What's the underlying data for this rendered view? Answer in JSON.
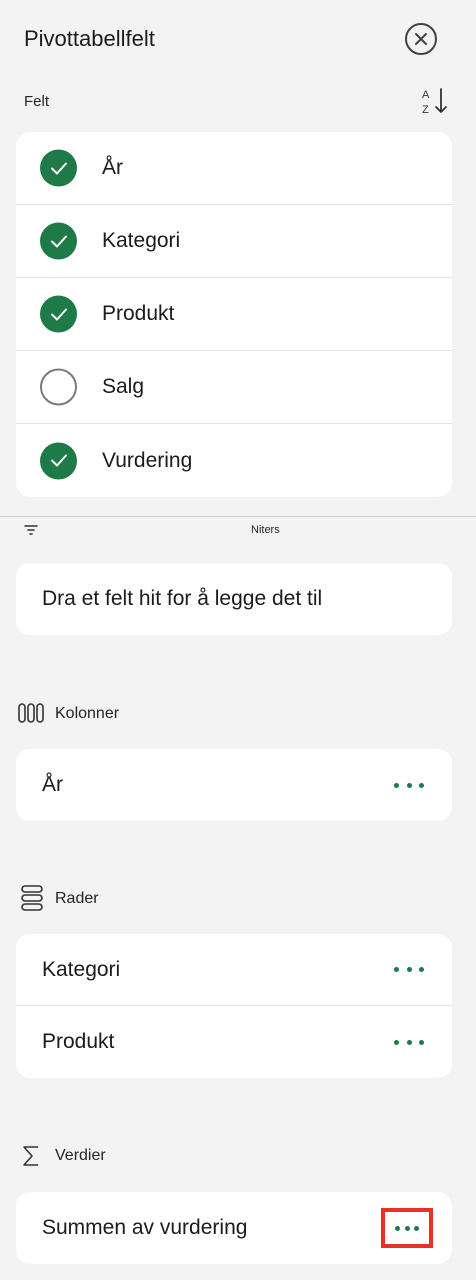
{
  "panel": {
    "title": "Pivottabellfelt"
  },
  "fields_section": {
    "label": "Felt",
    "items": [
      {
        "label": "År",
        "checked": true
      },
      {
        "label": "Kategori",
        "checked": true
      },
      {
        "label": "Produkt",
        "checked": true
      },
      {
        "label": "Salg",
        "checked": false
      },
      {
        "label": "Vurdering",
        "checked": true
      }
    ]
  },
  "filters": {
    "label": "Niters",
    "drop_hint": "Dra et felt hit for å legge det til"
  },
  "columns": {
    "label": "Kolonner",
    "items": [
      {
        "label": "År"
      }
    ]
  },
  "rows": {
    "label": "Rader",
    "items": [
      {
        "label": "Kategori"
      },
      {
        "label": "Produkt"
      }
    ]
  },
  "values": {
    "label": "Verdier",
    "items": [
      {
        "label": "Summen av vurdering"
      }
    ]
  },
  "colors": {
    "accent_green": "#1e7a46",
    "highlight_red": "#e8302a"
  }
}
